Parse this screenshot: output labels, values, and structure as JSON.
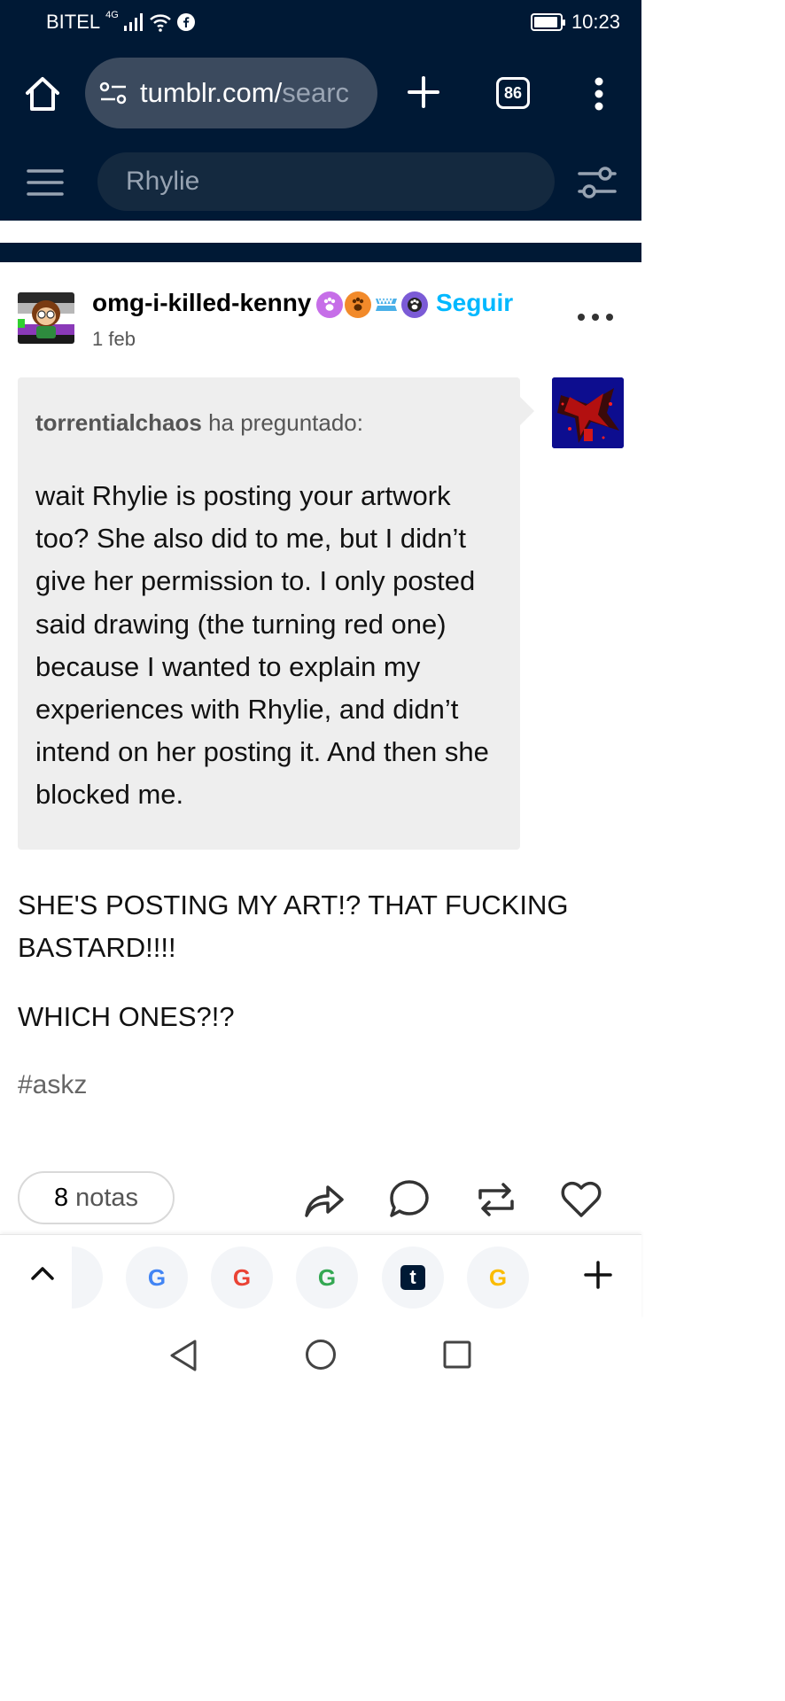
{
  "status_bar": {
    "carrier": "BITEL",
    "network": "4G",
    "time": "10:23"
  },
  "browser": {
    "url_visible": "tumblr.com/",
    "url_faded": "searc",
    "tab_count": "86"
  },
  "search": {
    "query": "Rhylie"
  },
  "post": {
    "blog_name": "omg-i-killed-kenny",
    "follow_label": "Seguir",
    "date": "1 feb",
    "asker_name": "torrentialchaos",
    "asker_suffix": "ha preguntado:",
    "question": "wait Rhylie is posting your artwork too? She also did to me, but I didn’t give her permission to. I only posted said drawing (the turning red one) because I wanted to explain my experiences with Rhylie, and didn’t intend on her posting it. And then she blocked me.",
    "answer_1": "SHE'S POSTING MY ART!? THAT FUCKING BASTARD!!!!",
    "answer_2": "WHICH ONES?!?",
    "tag": "#askz",
    "notes_count": "8",
    "notes_label": "notas"
  },
  "tab_strip": {
    "google_glyph": "G",
    "tumblr_glyph": "t"
  },
  "icons": [
    "home-icon",
    "site-settings-icon",
    "plus-icon",
    "tabs-icon",
    "more-vert-icon",
    "hamburger-icon",
    "filter-icon",
    "more-horiz-icon",
    "share-icon",
    "comment-icon",
    "reblog-icon",
    "heart-icon",
    "chevron-up-icon",
    "back-icon",
    "home-circle-icon",
    "recents-icon"
  ],
  "colors": {
    "tumblr_navy": "#001935",
    "follow_blue": "#00b8ff",
    "ask_bg": "#eeeeee"
  }
}
